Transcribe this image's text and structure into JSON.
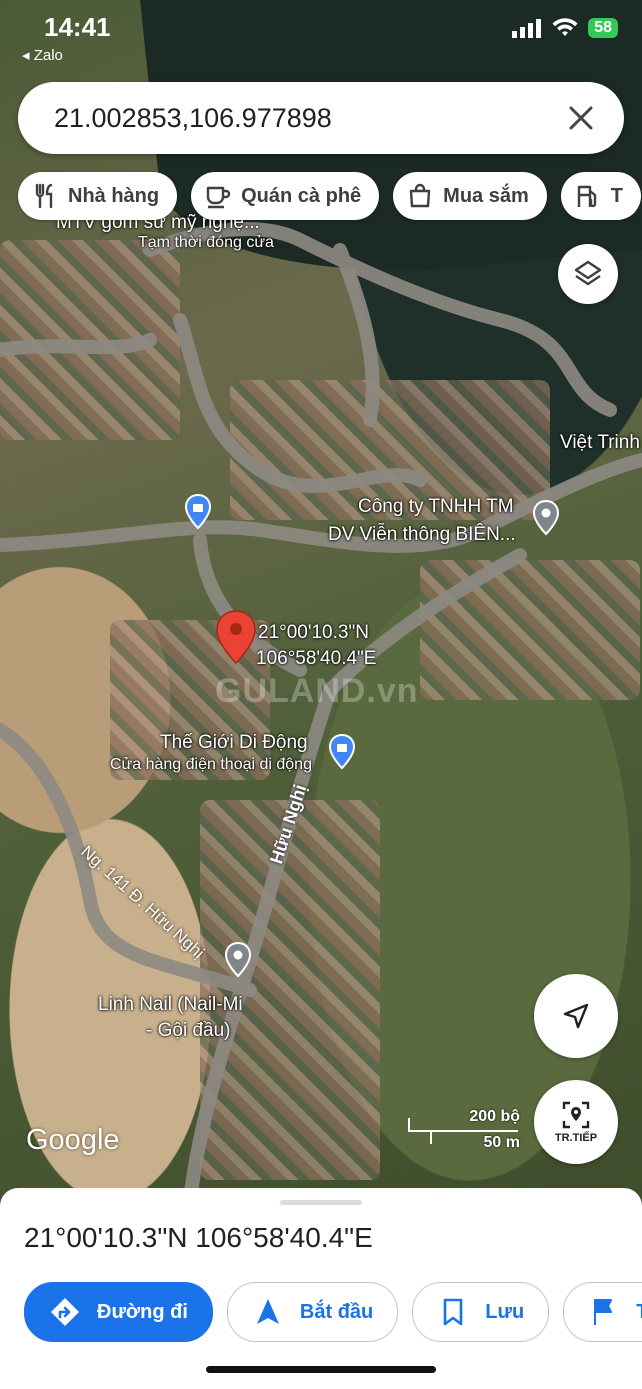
{
  "status_bar": {
    "time": "14:41",
    "back_app": "◂ Zalo",
    "battery": "58"
  },
  "search": {
    "query": "21.002853,106.977898"
  },
  "chips": [
    {
      "label": "Nhà hàng",
      "icon": "restaurant-icon"
    },
    {
      "label": "Quán cà phê",
      "icon": "coffee-icon"
    },
    {
      "label": "Mua sắm",
      "icon": "shopping-bag-icon"
    },
    {
      "label": "T",
      "icon": "fuel-icon"
    }
  ],
  "map": {
    "labels": {
      "gom_su": "MTV gốm sứ mỹ nghệ...",
      "gom_su_status": "Tạm thời đóng cửa",
      "viet_trinh": "Việt Trinh",
      "cong_ty_line1": "Công ty TNHH TM",
      "cong_ty_line2": "DV Viễn thông BIÊN...",
      "pin_coords_line1": "21°00'10.3\"N",
      "pin_coords_line2": "106°58'40.4\"E",
      "tgdd": "Thế Giới Di Động",
      "tgdd_sub": "Cửa hàng điện thoại di động",
      "linh_nail_line1": "Linh Nail (Nail-Mi",
      "linh_nail_line2": "- Gội đầu)",
      "road_huu_nghi": "Hữu Nghị",
      "road_ng141": "Ng. 141 Đ. Hữu Nghị",
      "watermark": "GULAND.vn"
    },
    "google_logo": "Google",
    "scale": {
      "top": "200 bộ",
      "bottom": "50 m"
    },
    "live_button_label": "TR.TIẾP"
  },
  "sheet": {
    "coords": "21°00'10.3\"N 106°58'40.4\"E",
    "actions": [
      {
        "label": "Đường đi",
        "icon": "directions-icon"
      },
      {
        "label": "Bắt đầu",
        "icon": "navigation-arrow-icon"
      },
      {
        "label": "Lưu",
        "icon": "bookmark-icon"
      },
      {
        "label": "T",
        "icon": "flag-icon"
      }
    ]
  },
  "colors": {
    "accent": "#1a73e8",
    "pin_red": "#ea4335",
    "battery_green": "#34c759"
  }
}
